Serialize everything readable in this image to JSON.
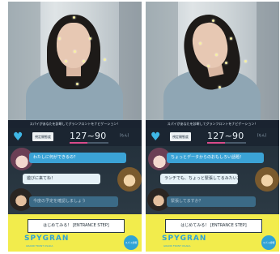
{
  "panels": [
    {
      "info_strip": "スパイがあなたを診断してグランフロントをナビゲーション！",
      "stat_label": "視定開態度",
      "stat_value": "127~90",
      "stat_unit": "[もん]",
      "stat_level": 0.45,
      "messages": [
        "わたしに何ができるの？",
        "遊びに来てね！",
        "今度の予定を確認しましょう"
      ],
      "cta_label": "はじめてみる！ [ENTRANCE STEP]",
      "logo": "SPYGRAN",
      "logo_sub": "GRAND FRONT OSAKA",
      "badge": "スパイ診断"
    },
    {
      "info_strip": "スパイがあなたを診断してグランフロントをナビゲーション！",
      "stat_label": "視定開態度",
      "stat_value": "127~90",
      "stat_unit": "[もん]",
      "stat_level": 0.45,
      "messages": [
        "ちょっとデータからのおもしろい話題！",
        "ランチでも、ちょっと緊張してるみたいだね！",
        "緊張してますか？"
      ],
      "cta_label": "はじめてみる！ [ENTRANCE STEP]",
      "logo": "SPYGRAN",
      "logo_sub": "GRAND FRONT OSAKA",
      "badge": "スパイ診断"
    }
  ],
  "colors": {
    "accent_blue": "#3ba3d6",
    "cta_yellow": "#f2ec4c",
    "dark_panel": "#1e2833",
    "bar_pink": "#d94a8a"
  }
}
